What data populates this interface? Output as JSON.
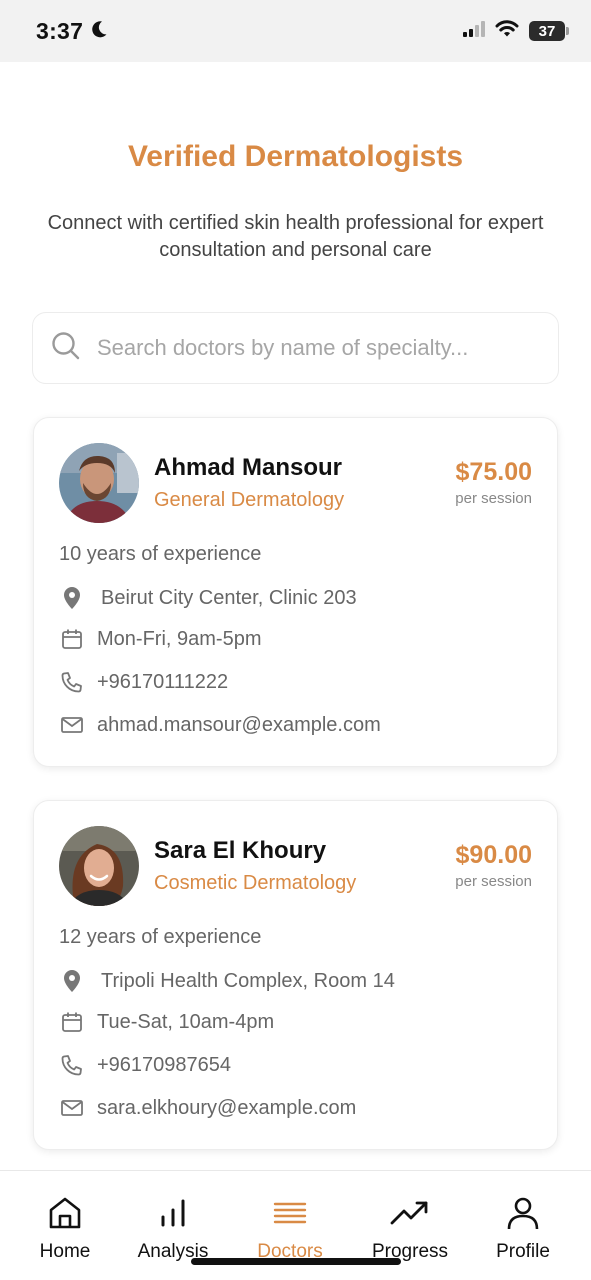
{
  "status_bar": {
    "time": "3:37",
    "battery": "37"
  },
  "header": {
    "title": "Verified Dermatologists",
    "subtitle": "Connect with certified skin health professional for expert consultation and personal care"
  },
  "search": {
    "placeholder": "Search doctors by name of specialty..."
  },
  "doctors": [
    {
      "name": "Ahmad Mansour",
      "specialty": "General Dermatology",
      "price": "$75.00",
      "price_unit": "per session",
      "experience": "10 years of experience",
      "location": "Beirut City Center, Clinic 203",
      "hours": "Mon-Fri, 9am-5pm",
      "phone": "+96170111222",
      "email": "ahmad.mansour@example.com"
    },
    {
      "name": "Sara El Khoury",
      "specialty": "Cosmetic Dermatology",
      "price": "$90.00",
      "price_unit": "per session",
      "experience": "12 years of experience",
      "location": "Tripoli Health Complex, Room 14",
      "hours": "Tue-Sat, 10am-4pm",
      "phone": "+96170987654",
      "email": "sara.elkhoury@example.com"
    }
  ],
  "nav": {
    "items": [
      {
        "label": "Home",
        "icon": "home-icon"
      },
      {
        "label": "Analysis",
        "icon": "bar-chart-icon"
      },
      {
        "label": "Doctors",
        "icon": "menu-lines-icon"
      },
      {
        "label": "Progress",
        "icon": "trending-up-icon"
      },
      {
        "label": "Profile",
        "icon": "user-icon"
      }
    ],
    "active": "Doctors"
  },
  "colors": {
    "accent": "#d98a45",
    "text_primary": "#111111",
    "text_secondary": "#666666",
    "status_bar_bg": "#f2f2f2"
  }
}
